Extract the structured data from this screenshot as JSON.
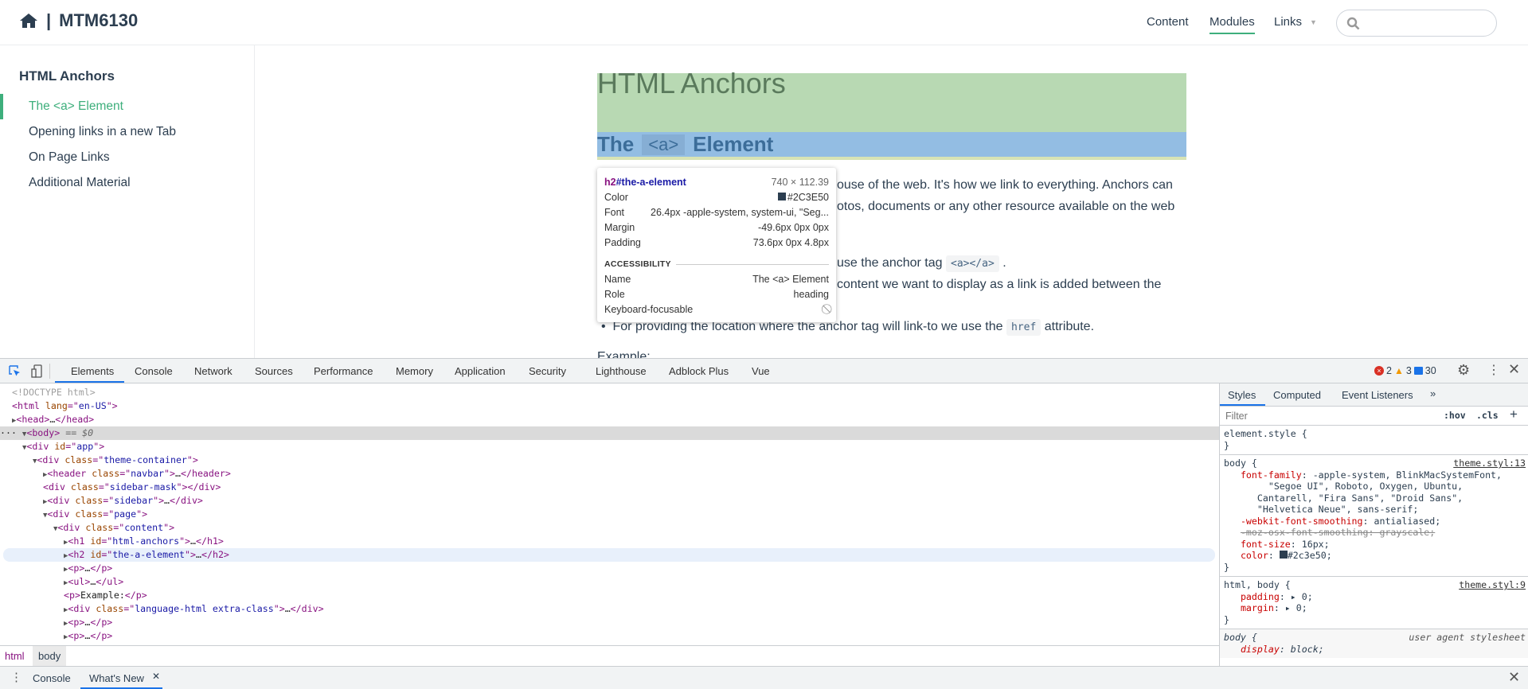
{
  "navbar": {
    "brand": "MTM6130",
    "separator": "|",
    "links": [
      {
        "label": "Content"
      },
      {
        "label": "Modules",
        "active": true
      },
      {
        "label": "Links",
        "has_dropdown": true
      }
    ],
    "search_placeholder": ""
  },
  "sidebar": {
    "title": "HTML Anchors",
    "items": [
      {
        "label": "The <a> Element",
        "active": true
      },
      {
        "label": "Opening links in a new Tab"
      },
      {
        "label": "On Page Links"
      },
      {
        "label": "Additional Material"
      }
    ]
  },
  "content": {
    "h1": "HTML Anchors",
    "h2_pre": "The",
    "h2_code": "<a>",
    "h2_post": "Element",
    "p1_line1": "ouse of the web. It's how we link to everything. Anchors can",
    "p1_line2": "otos, documents or any other resource available on the web",
    "li1_text": "use the anchor tag",
    "li1_code": "<a></a>",
    "li1_end": ".",
    "li2_text": "content we want to display as a link is added between the",
    "li3_text": "For providing the location where the anchor tag will link-to we use the",
    "li3_code": "href",
    "li3_end": "attribute.",
    "example": "Example:"
  },
  "tooltip": {
    "selector_tag": "h2",
    "selector_id": "#the-a-element",
    "size": "740 × 112.39",
    "color_label": "Color",
    "color_value": "#2C3E50",
    "font_label": "Font",
    "font_value": "26.4px -apple-system, system-ui, \"Seg...",
    "margin_label": "Margin",
    "margin_value": "-49.6px 0px 0px",
    "padding_label": "Padding",
    "padding_value": "73.6px 0px 4.8px",
    "accessibility_label": "ACCESSIBILITY",
    "name_label": "Name",
    "name_value": "The <a> Element",
    "role_label": "Role",
    "role_value": "heading",
    "focusable_label": "Keyboard-focusable"
  },
  "devtools": {
    "tabs": [
      "Elements",
      "Console",
      "Network",
      "Sources",
      "Performance",
      "Memory",
      "Application",
      "Security",
      "Lighthouse",
      "Adblock Plus",
      "Vue"
    ],
    "active_tab": "Elements",
    "errors": "2",
    "warnings": "3",
    "messages": "30",
    "dom_lines": [
      {
        "indent": 0,
        "t": "comment",
        "text": "<!DOCTYPE html>"
      },
      {
        "indent": 0,
        "t": "open",
        "tag": "html",
        "attrs": [
          [
            "lang",
            "en-US"
          ]
        ]
      },
      {
        "indent": 0,
        "t": "collapsed",
        "tag": "head",
        "arrow": "right"
      },
      {
        "indent": 0,
        "t": "open",
        "tag": "body",
        "arrow": "down",
        "suffix": " == $0",
        "selected": true
      },
      {
        "indent": 1,
        "t": "open",
        "tag": "div",
        "attrs": [
          [
            "id",
            "app"
          ]
        ],
        "arrow": "down"
      },
      {
        "indent": 2,
        "t": "open",
        "tag": "div",
        "attrs": [
          [
            "class",
            "theme-container"
          ]
        ],
        "arrow": "down"
      },
      {
        "indent": 3,
        "t": "collapsed",
        "tag": "header",
        "attrs": [
          [
            "class",
            "navbar"
          ]
        ],
        "arrow": "right"
      },
      {
        "indent": 3,
        "t": "empty",
        "tag": "div",
        "attrs": [
          [
            "class",
            "sidebar-mask"
          ]
        ]
      },
      {
        "indent": 3,
        "t": "collapsed",
        "tag": "div",
        "attrs": [
          [
            "class",
            "sidebar"
          ]
        ],
        "arrow": "right"
      },
      {
        "indent": 3,
        "t": "open",
        "tag": "div",
        "attrs": [
          [
            "class",
            "page"
          ]
        ],
        "arrow": "down"
      },
      {
        "indent": 4,
        "t": "open",
        "tag": "div",
        "attrs": [
          [
            "class",
            "content"
          ]
        ],
        "arrow": "down"
      },
      {
        "indent": 5,
        "t": "collapsed",
        "tag": "h1",
        "attrs": [
          [
            "id",
            "html-anchors"
          ]
        ],
        "arrow": "right"
      },
      {
        "indent": 5,
        "t": "collapsed",
        "tag": "h2",
        "attrs": [
          [
            "id",
            "the-a-element"
          ]
        ],
        "arrow": "right",
        "hovered": true
      },
      {
        "indent": 5,
        "t": "collapsed",
        "tag": "p",
        "arrow": "right"
      },
      {
        "indent": 5,
        "t": "collapsed",
        "tag": "ul",
        "arrow": "right"
      },
      {
        "indent": 5,
        "t": "text",
        "tag": "p",
        "text": "Example:"
      },
      {
        "indent": 5,
        "t": "collapsed",
        "tag": "div",
        "attrs": [
          [
            "class",
            "language-html extra-class"
          ]
        ],
        "arrow": "right"
      },
      {
        "indent": 5,
        "t": "collapsed",
        "tag": "p",
        "arrow": "right"
      },
      {
        "indent": 5,
        "t": "collapsed",
        "tag": "p",
        "arrow": "right"
      }
    ],
    "breadcrumbs": [
      "html",
      "body"
    ],
    "drawer_tabs": [
      "Console",
      "What's New"
    ],
    "styles": {
      "tabs": [
        "Styles",
        "Computed",
        "Event Listeners"
      ],
      "filter_placeholder": "Filter",
      "hov": ":hov",
      "cls": ".cls",
      "element_style": "element.style {",
      "close_brace": "}",
      "body_sel": "body {",
      "body_src": "theme.styl:13",
      "ff_name": "font-family",
      "ff_val1": " -apple-system, BlinkMacSystemFont,",
      "ff_val2": "\"Segoe UI\", Roboto, Oxygen, Ubuntu,",
      "ff_val3": "Cantarell, \"Fira Sans\", \"Droid Sans\",",
      "ff_val4": "\"Helvetica Neue\", sans-serif;",
      "wfs_name": "-webkit-font-smoothing",
      "wfs_val": " antialiased;",
      "moz": "-moz-osx-font-smoothing: grayscale;",
      "fs_name": "font-size",
      "fs_val": " 16px;",
      "color_name": "color",
      "color_val": "#2c3e50;",
      "color_swatch": "#2c3e50",
      "hb_sel": "html, body {",
      "hb_src": "theme.styl:9",
      "pad_name": "padding",
      "pad_val": "0;",
      "mar_name": "margin",
      "mar_val": "0;",
      "ua_sel": "body {",
      "ua_src": "user agent stylesheet",
      "disp_name": "display",
      "disp_val": " block;"
    }
  },
  "colors": {
    "accent": "#3eaf7c",
    "text": "#2c3e50",
    "devtools_blue": "#1a73e8"
  }
}
